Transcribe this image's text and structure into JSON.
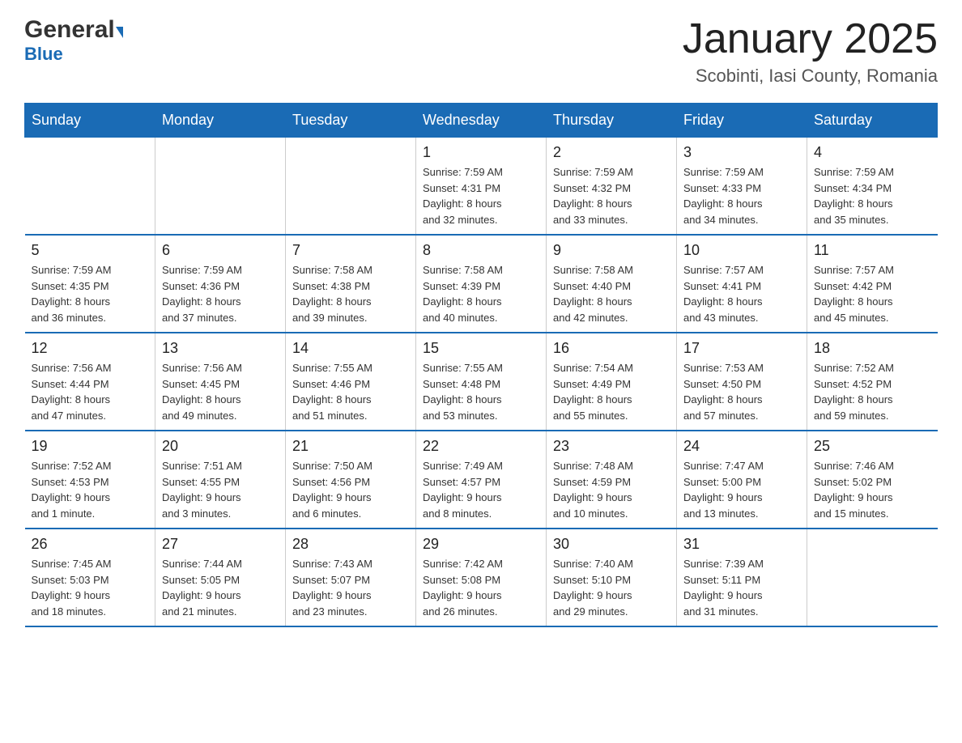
{
  "header": {
    "logo_general": "General",
    "logo_blue": "Blue",
    "month_title": "January 2025",
    "location": "Scobinti, Iasi County, Romania"
  },
  "days_of_week": [
    "Sunday",
    "Monday",
    "Tuesday",
    "Wednesday",
    "Thursday",
    "Friday",
    "Saturday"
  ],
  "weeks": [
    [
      {
        "day": "",
        "info": ""
      },
      {
        "day": "",
        "info": ""
      },
      {
        "day": "",
        "info": ""
      },
      {
        "day": "1",
        "info": "Sunrise: 7:59 AM\nSunset: 4:31 PM\nDaylight: 8 hours\nand 32 minutes."
      },
      {
        "day": "2",
        "info": "Sunrise: 7:59 AM\nSunset: 4:32 PM\nDaylight: 8 hours\nand 33 minutes."
      },
      {
        "day": "3",
        "info": "Sunrise: 7:59 AM\nSunset: 4:33 PM\nDaylight: 8 hours\nand 34 minutes."
      },
      {
        "day": "4",
        "info": "Sunrise: 7:59 AM\nSunset: 4:34 PM\nDaylight: 8 hours\nand 35 minutes."
      }
    ],
    [
      {
        "day": "5",
        "info": "Sunrise: 7:59 AM\nSunset: 4:35 PM\nDaylight: 8 hours\nand 36 minutes."
      },
      {
        "day": "6",
        "info": "Sunrise: 7:59 AM\nSunset: 4:36 PM\nDaylight: 8 hours\nand 37 minutes."
      },
      {
        "day": "7",
        "info": "Sunrise: 7:58 AM\nSunset: 4:38 PM\nDaylight: 8 hours\nand 39 minutes."
      },
      {
        "day": "8",
        "info": "Sunrise: 7:58 AM\nSunset: 4:39 PM\nDaylight: 8 hours\nand 40 minutes."
      },
      {
        "day": "9",
        "info": "Sunrise: 7:58 AM\nSunset: 4:40 PM\nDaylight: 8 hours\nand 42 minutes."
      },
      {
        "day": "10",
        "info": "Sunrise: 7:57 AM\nSunset: 4:41 PM\nDaylight: 8 hours\nand 43 minutes."
      },
      {
        "day": "11",
        "info": "Sunrise: 7:57 AM\nSunset: 4:42 PM\nDaylight: 8 hours\nand 45 minutes."
      }
    ],
    [
      {
        "day": "12",
        "info": "Sunrise: 7:56 AM\nSunset: 4:44 PM\nDaylight: 8 hours\nand 47 minutes."
      },
      {
        "day": "13",
        "info": "Sunrise: 7:56 AM\nSunset: 4:45 PM\nDaylight: 8 hours\nand 49 minutes."
      },
      {
        "day": "14",
        "info": "Sunrise: 7:55 AM\nSunset: 4:46 PM\nDaylight: 8 hours\nand 51 minutes."
      },
      {
        "day": "15",
        "info": "Sunrise: 7:55 AM\nSunset: 4:48 PM\nDaylight: 8 hours\nand 53 minutes."
      },
      {
        "day": "16",
        "info": "Sunrise: 7:54 AM\nSunset: 4:49 PM\nDaylight: 8 hours\nand 55 minutes."
      },
      {
        "day": "17",
        "info": "Sunrise: 7:53 AM\nSunset: 4:50 PM\nDaylight: 8 hours\nand 57 minutes."
      },
      {
        "day": "18",
        "info": "Sunrise: 7:52 AM\nSunset: 4:52 PM\nDaylight: 8 hours\nand 59 minutes."
      }
    ],
    [
      {
        "day": "19",
        "info": "Sunrise: 7:52 AM\nSunset: 4:53 PM\nDaylight: 9 hours\nand 1 minute."
      },
      {
        "day": "20",
        "info": "Sunrise: 7:51 AM\nSunset: 4:55 PM\nDaylight: 9 hours\nand 3 minutes."
      },
      {
        "day": "21",
        "info": "Sunrise: 7:50 AM\nSunset: 4:56 PM\nDaylight: 9 hours\nand 6 minutes."
      },
      {
        "day": "22",
        "info": "Sunrise: 7:49 AM\nSunset: 4:57 PM\nDaylight: 9 hours\nand 8 minutes."
      },
      {
        "day": "23",
        "info": "Sunrise: 7:48 AM\nSunset: 4:59 PM\nDaylight: 9 hours\nand 10 minutes."
      },
      {
        "day": "24",
        "info": "Sunrise: 7:47 AM\nSunset: 5:00 PM\nDaylight: 9 hours\nand 13 minutes."
      },
      {
        "day": "25",
        "info": "Sunrise: 7:46 AM\nSunset: 5:02 PM\nDaylight: 9 hours\nand 15 minutes."
      }
    ],
    [
      {
        "day": "26",
        "info": "Sunrise: 7:45 AM\nSunset: 5:03 PM\nDaylight: 9 hours\nand 18 minutes."
      },
      {
        "day": "27",
        "info": "Sunrise: 7:44 AM\nSunset: 5:05 PM\nDaylight: 9 hours\nand 21 minutes."
      },
      {
        "day": "28",
        "info": "Sunrise: 7:43 AM\nSunset: 5:07 PM\nDaylight: 9 hours\nand 23 minutes."
      },
      {
        "day": "29",
        "info": "Sunrise: 7:42 AM\nSunset: 5:08 PM\nDaylight: 9 hours\nand 26 minutes."
      },
      {
        "day": "30",
        "info": "Sunrise: 7:40 AM\nSunset: 5:10 PM\nDaylight: 9 hours\nand 29 minutes."
      },
      {
        "day": "31",
        "info": "Sunrise: 7:39 AM\nSunset: 5:11 PM\nDaylight: 9 hours\nand 31 minutes."
      },
      {
        "day": "",
        "info": ""
      }
    ]
  ]
}
